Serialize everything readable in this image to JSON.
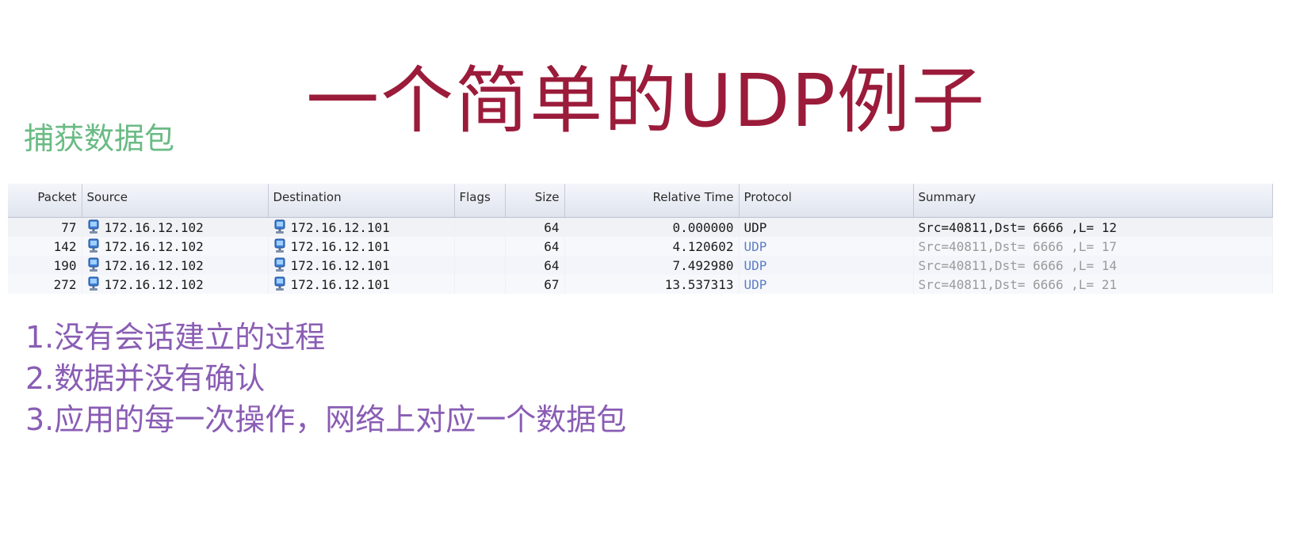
{
  "slide": {
    "title": "一个简单的UDP例子",
    "subheading": "捕获数据包",
    "notes": [
      "1.没有会话建立的过程",
      "2.数据并没有确认",
      "3.应用的每一次操作，网络上对应一个数据包"
    ],
    "colors": {
      "title": "#9b1b3a",
      "subheading": "#6abb84",
      "notes": "#8a5db4"
    }
  },
  "packet_table": {
    "columns": [
      "Packet",
      "Source",
      "Destination",
      "Flags",
      "Size",
      "Relative Time",
      "Protocol",
      "Summary"
    ],
    "host_icon": "network-host-icon",
    "rows": [
      {
        "packet": "77",
        "source": "172.16.12.102",
        "destination": "172.16.12.101",
        "flags": "",
        "size": "64",
        "time": "0.000000",
        "protocol": "UDP",
        "summary": "Src=40811,Dst= 6666 ,L=   12"
      },
      {
        "packet": "142",
        "source": "172.16.12.102",
        "destination": "172.16.12.101",
        "flags": "",
        "size": "64",
        "time": "4.120602",
        "protocol": "UDP",
        "summary": "Src=40811,Dst= 6666 ,L=   17"
      },
      {
        "packet": "190",
        "source": "172.16.12.102",
        "destination": "172.16.12.101",
        "flags": "",
        "size": "64",
        "time": "7.492980",
        "protocol": "UDP",
        "summary": "Src=40811,Dst= 6666 ,L=   14"
      },
      {
        "packet": "272",
        "source": "172.16.12.102",
        "destination": "172.16.12.101",
        "flags": "",
        "size": "67",
        "time": "13.537313",
        "protocol": "UDP",
        "summary": "Src=40811,Dst= 6666 ,L=   21"
      }
    ]
  }
}
